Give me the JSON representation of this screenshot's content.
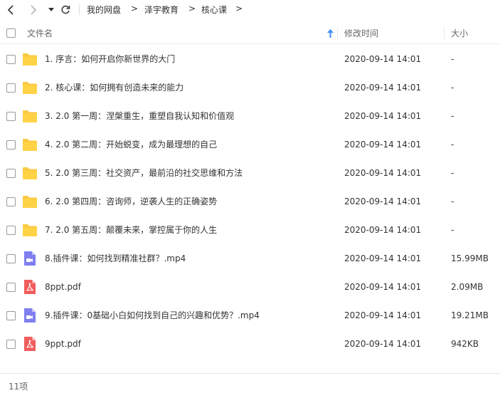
{
  "breadcrumb": {
    "items": [
      "我的网盘",
      "泽宇教育",
      "核心课"
    ],
    "separator": ">"
  },
  "icons": {
    "back": "chevron-left-icon",
    "forward": "chevron-right-icon",
    "history": "caret-down-icon",
    "refresh": "refresh-icon",
    "folder": "folder-icon",
    "video": "video-file-icon",
    "pdf": "pdf-file-icon",
    "sort": "sort-arrow-up-icon"
  },
  "colors": {
    "folder": "#f9c942",
    "video": "#7f7ff0",
    "pdf": "#f25c5c",
    "sort_arrow": "#3b8cff"
  },
  "header": {
    "name": "文件名",
    "modified": "修改时间",
    "size": "大小"
  },
  "files": [
    {
      "name": "1. 序言：如何开启你新世界的大门",
      "type": "folder",
      "date": "2020-09-14 14:01",
      "size": "-"
    },
    {
      "name": "2. 核心课：如何拥有创造未来的能力",
      "type": "folder",
      "date": "2020-09-14 14:01",
      "size": "-"
    },
    {
      "name": "3. 2.0 第一周：涅槃重生，重塑自我认知和价值观",
      "type": "folder",
      "date": "2020-09-14 14:01",
      "size": "-"
    },
    {
      "name": "4. 2.0 第二周：开始蜕变，成为最理想的自己",
      "type": "folder",
      "date": "2020-09-14 14:01",
      "size": "-"
    },
    {
      "name": "5. 2.0 第三周：社交资产，最前沿的社交思维和方法",
      "type": "folder",
      "date": "2020-09-14 14:01",
      "size": "-"
    },
    {
      "name": "6. 2.0 第四周：咨询师，逆袭人生的正确姿势",
      "type": "folder",
      "date": "2020-09-14 14:01",
      "size": "-"
    },
    {
      "name": "7. 2.0 第五周：颠覆未来，掌控属于你的人生",
      "type": "folder",
      "date": "2020-09-14 14:01",
      "size": "-"
    },
    {
      "name": "8.插件课：如何找到精准社群？.mp4",
      "type": "video",
      "date": "2020-09-14 14:01",
      "size": "15.99MB"
    },
    {
      "name": "8ppt.pdf",
      "type": "pdf",
      "date": "2020-09-14 14:01",
      "size": "2.09MB"
    },
    {
      "name": "9.插件课：0基础小白如何找到自己的兴趣和优势？.mp4",
      "type": "video",
      "date": "2020-09-14 14:01",
      "size": "19.21MB"
    },
    {
      "name": "9ppt.pdf",
      "type": "pdf",
      "date": "2020-09-14 14:01",
      "size": "942KB"
    }
  ],
  "footer": {
    "count": "11项"
  }
}
